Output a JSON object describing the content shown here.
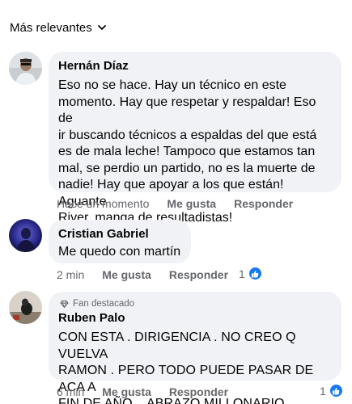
{
  "sort": {
    "label": "Más relevantes"
  },
  "comments": [
    {
      "author": "Hernán Díaz",
      "text": "Eso no se hace. Hay un técnico en este momento. Hay que respetar y respaldar! Eso de ir buscando técnicos a espaldas del que está es de mala leche! Tampoco que estamos tan mal, se perdio un partido, no es la muerte de nadie! Hay que apoyar a los que están! Aguante River, manga de resultadistas!",
      "lines": [
        "Eso no se hace. Hay un técnico en este",
        "momento. Hay que respetar y respaldar! Eso de",
        "ir buscando técnicos a espaldas del que está",
        "es de mala leche! Tampoco que estamos tan",
        "mal, se perdio un partido, no es la muerte de",
        "nadie! Hay que apoyar a los que están! Aguante",
        "River, manga de resultadistas!"
      ],
      "time": "Hace un momento",
      "like_label": "Me gusta",
      "reply_label": "Responder"
    },
    {
      "author": "Cristian Gabriel",
      "text": "Me quedo con martín",
      "time": "2 min",
      "like_label": "Me gusta",
      "reply_label": "Responder",
      "reactions": "1"
    },
    {
      "badge": "Fan destacado",
      "author": "Ruben Palo",
      "lines": [
        "CON ESTA . DIRIGENCIA . NO CREO Q VUELVA",
        "RAMON . PERO TODO PUEDE PASAR DE ACA A",
        "FIN DE AÑO .. ABRAZO MILLONARIO .."
      ],
      "time": "6 min",
      "like_label": "Me gusta",
      "reply_label": "Responder",
      "reactions": "1"
    }
  ],
  "colors": {
    "bubble": "#f0f2f5",
    "secondary_text": "#65676b",
    "like_blue": "#1877f2"
  }
}
